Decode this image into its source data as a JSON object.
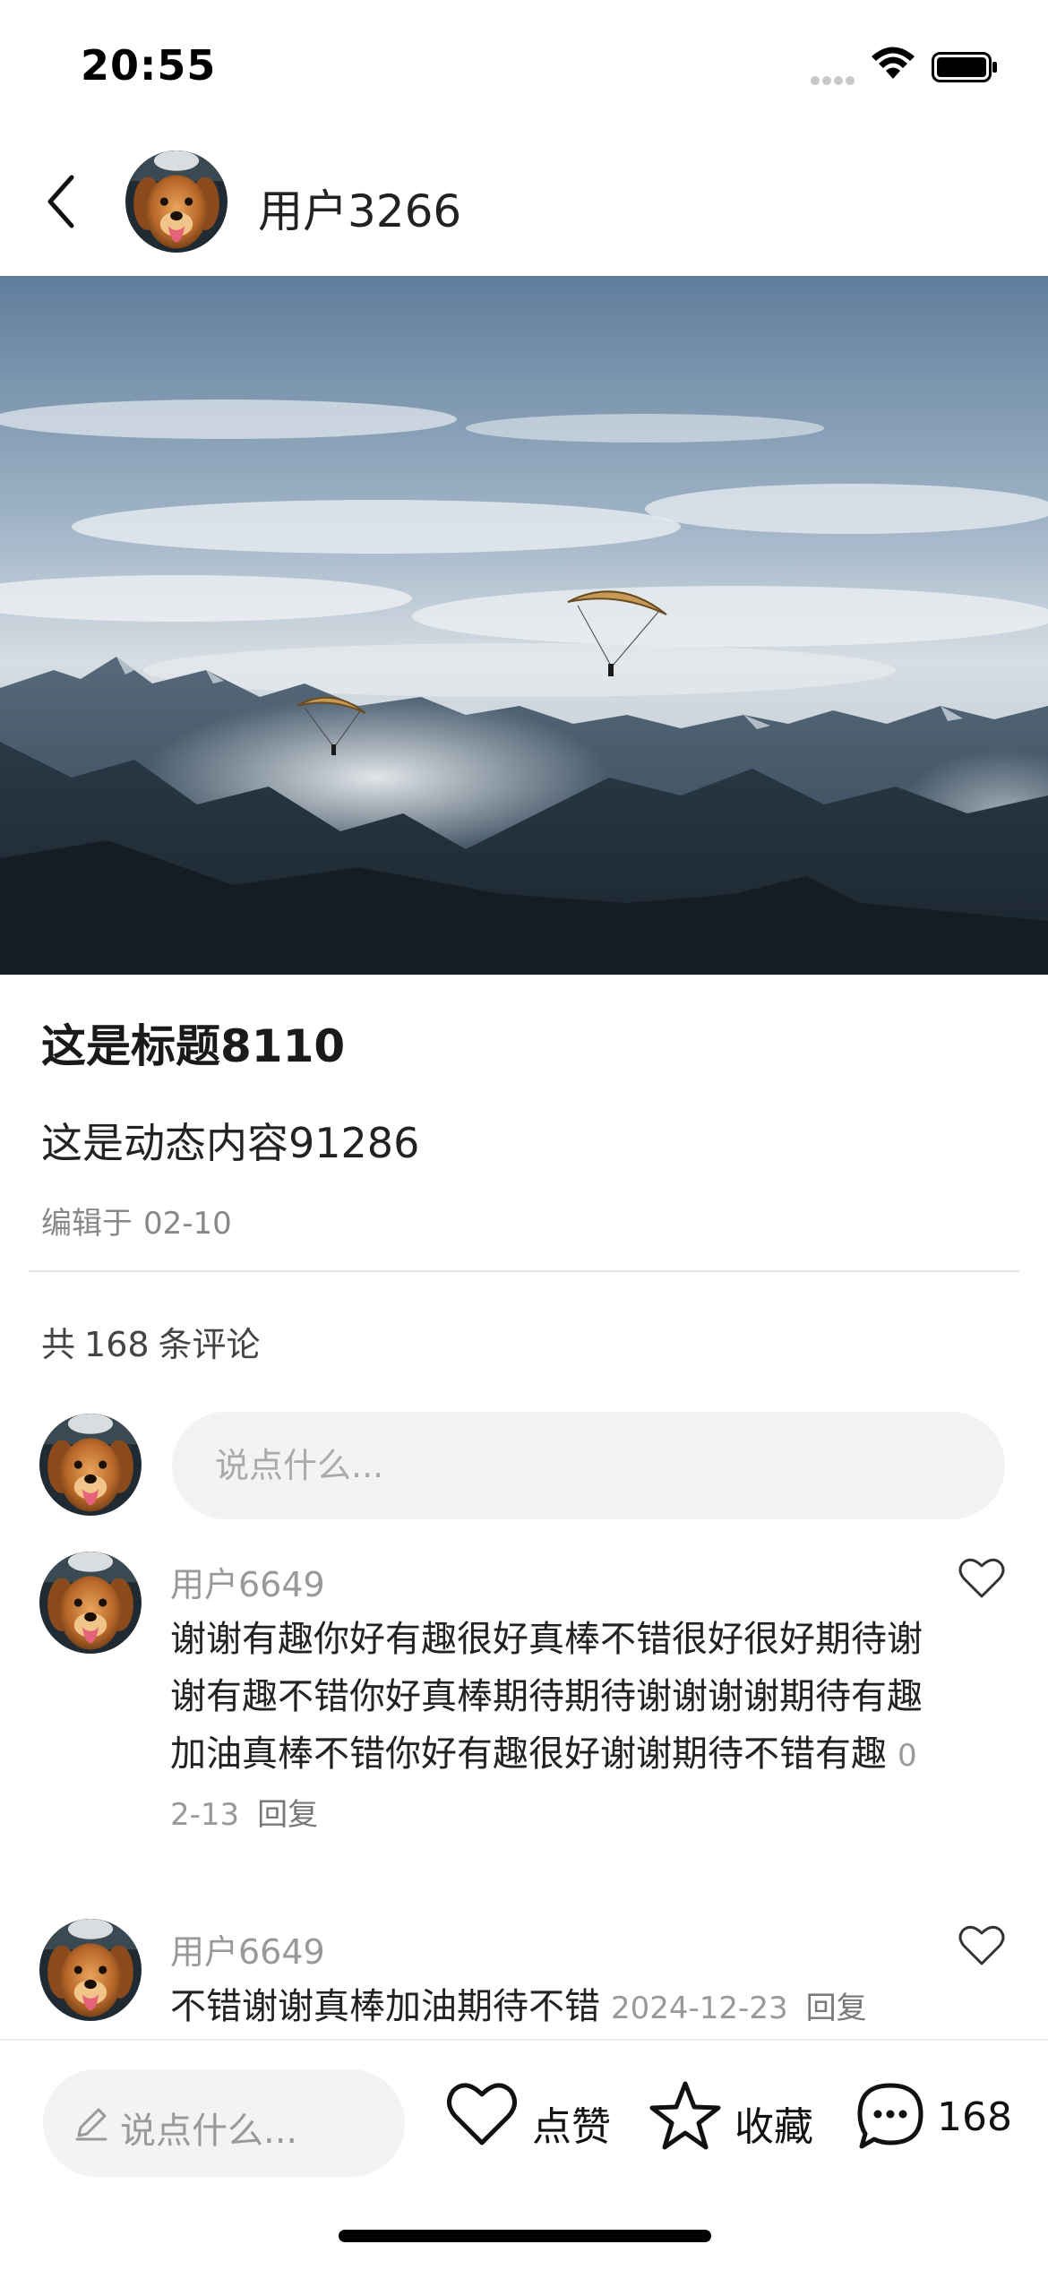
{
  "status_bar": {
    "time": "20:55"
  },
  "header": {
    "username": "用户3266"
  },
  "post": {
    "title": "这是标题8110",
    "content": "这是动态内容91286",
    "edited_prefix": "编辑于",
    "edited_date": "02-10"
  },
  "comments_summary": {
    "prefix": "共",
    "count": "168",
    "suffix": "条评论"
  },
  "comment_input": {
    "placeholder": "说点什么..."
  },
  "comments": [
    {
      "user": "用户6649",
      "text": "谢谢有趣你好有趣很好真棒不错很好很好期待谢谢有趣不错你好真棒期待期待谢谢谢谢期待有趣加油真棒不错你好有趣很好谢谢期待不错有趣",
      "date": "02-13",
      "reply": "回复"
    },
    {
      "user": "用户6649",
      "text": "不错谢谢真棒加油期待不错",
      "date": "2024-12-23",
      "reply": "回复"
    }
  ],
  "bottom_bar": {
    "input_placeholder": "说点什么...",
    "like_label": "点赞",
    "favorite_label": "收藏",
    "comment_count": "168"
  },
  "icons": {
    "back": "chevron-left-icon",
    "like": "heart-outline-icon",
    "favorite": "star-outline-icon",
    "comment": "chat-bubble-icon",
    "edit": "pencil-icon"
  }
}
